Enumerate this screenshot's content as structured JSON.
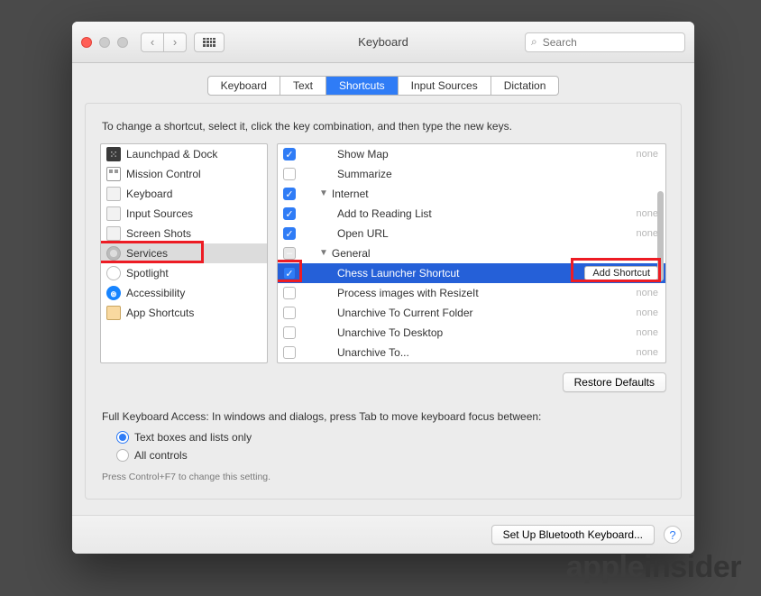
{
  "header": {
    "title": "Keyboard",
    "search_placeholder": "Search"
  },
  "tabs": [
    "Keyboard",
    "Text",
    "Shortcuts",
    "Input Sources",
    "Dictation"
  ],
  "instructions": "To change a shortcut, select it, click the key combination, and then type the new keys.",
  "sidebar": [
    "Launchpad & Dock",
    "Mission Control",
    "Keyboard",
    "Input Sources",
    "Screen Shots",
    "Services",
    "Spotlight",
    "Accessibility",
    "App Shortcuts"
  ],
  "list": [
    {
      "label": "Show Map",
      "shortcut": "none",
      "checked": true
    },
    {
      "label": "Summarize",
      "shortcut": "",
      "checked": false
    },
    {
      "label": "Internet",
      "shortcut": "",
      "group": true
    },
    {
      "label": "Add to Reading List",
      "shortcut": "none",
      "checked": true
    },
    {
      "label": "Open URL",
      "shortcut": "none",
      "checked": true
    },
    {
      "label": "General",
      "shortcut": "",
      "group": true
    },
    {
      "label": "Chess Launcher Shortcut",
      "shortcut": "",
      "checked": true,
      "selected": true
    },
    {
      "label": "Process images with ResizeIt",
      "shortcut": "none",
      "checked": false
    },
    {
      "label": "Unarchive To Current Folder",
      "shortcut": "none",
      "checked": false
    },
    {
      "label": "Unarchive To Desktop",
      "shortcut": "none",
      "checked": false
    },
    {
      "label": "Unarchive To...",
      "shortcut": "none",
      "checked": false
    }
  ],
  "add_shortcut_btn": "Add Shortcut",
  "restore_defaults": "Restore Defaults",
  "access_label": "Full Keyboard Access: In windows and dialogs, press Tab to move keyboard focus between:",
  "radios": [
    "Text boxes and lists only",
    "All controls"
  ],
  "hint": "Press Control+F7 to change this setting.",
  "footer": {
    "bluetooth": "Set Up Bluetooth Keyboard..."
  },
  "watermark": {
    "a": "apple",
    "b": "insider"
  }
}
